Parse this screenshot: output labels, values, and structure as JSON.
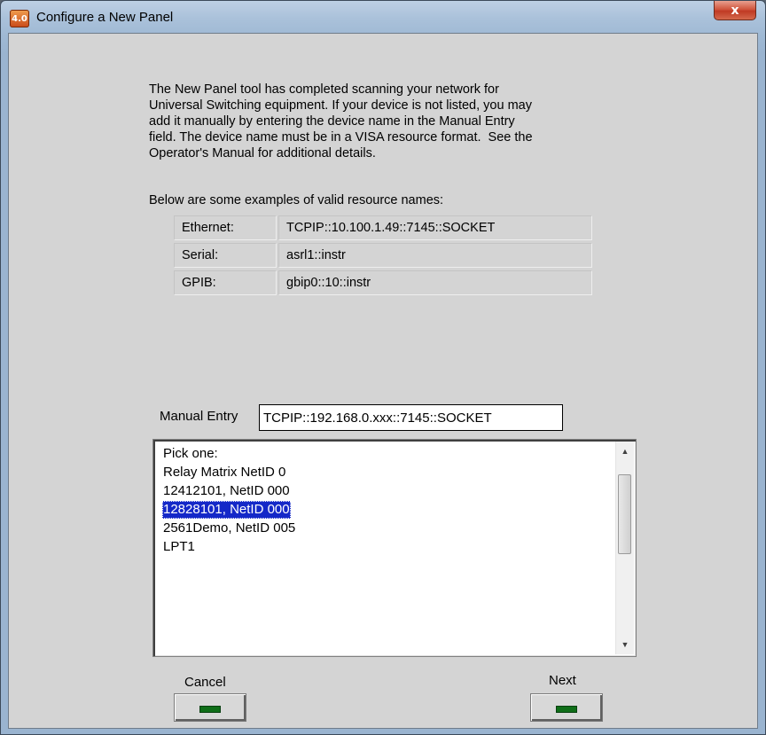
{
  "window": {
    "title": "Configure a New Panel",
    "app_icon_text": "4.0",
    "close_glyph": "x"
  },
  "intro": {
    "text": "The New Panel tool has completed scanning your network for\nUniversal Switching equipment. If your device is not listed, you may\nadd it manually by entering the device name in the Manual Entry\nfield. The device name must be in a VISA resource format.  See the\nOperator's Manual for additional details.",
    "examples_label": "Below are some examples of valid resource names:"
  },
  "examples": [
    {
      "type": "Ethernet:",
      "value": "TCPIP::10.100.1.49::7145::SOCKET"
    },
    {
      "type": "Serial:",
      "value": "asrl1::instr"
    },
    {
      "type": "GPIB:",
      "value": "gbip0::10::instr"
    }
  ],
  "manual_entry": {
    "label": "Manual Entry",
    "value": "TCPIP::192.168.0.xxx::7145::SOCKET"
  },
  "device_list": {
    "items": [
      "Pick one:",
      "Relay Matrix NetID 0",
      "12412101, NetID 000",
      "12828101, NetID 000",
      "2561Demo, NetID 005",
      "LPT1"
    ],
    "selected_index": 3
  },
  "buttons": {
    "cancel_label": "Cancel",
    "next_label": "Next"
  },
  "colors": {
    "selection": "#1428c8",
    "led": "#0f6e18",
    "close_button": "#c03a24"
  }
}
